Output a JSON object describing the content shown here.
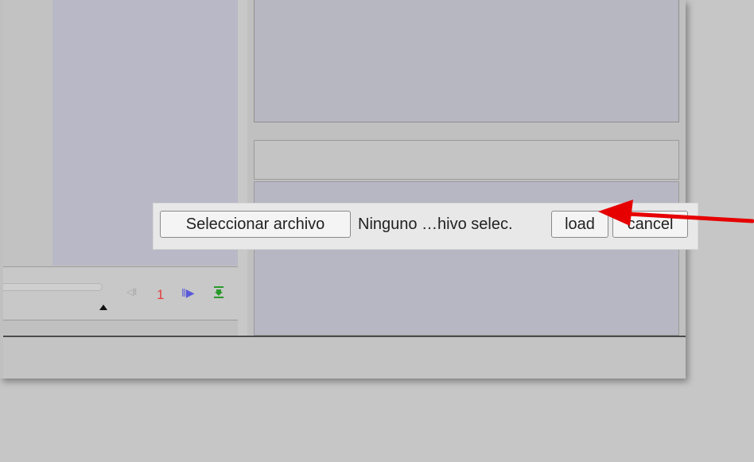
{
  "pager": {
    "prev_icon": "step-back-icon",
    "current_page": "1",
    "next_icon": "step-forward-icon",
    "export_icon": "export-icon"
  },
  "upload": {
    "choose_file_label": "Seleccionar archivo",
    "file_status": "Ninguno …hivo selec.",
    "load_label": "load",
    "cancel_label": "cancel"
  },
  "annotation": {
    "arrow_color": "#e60000",
    "arrow_icon": "red-arrow"
  },
  "colors": {
    "panel_bg": "#b7b7c4",
    "page_number": "#e43c3c",
    "nav_next": "#5a5ad8",
    "export": "#2a9a2a"
  }
}
